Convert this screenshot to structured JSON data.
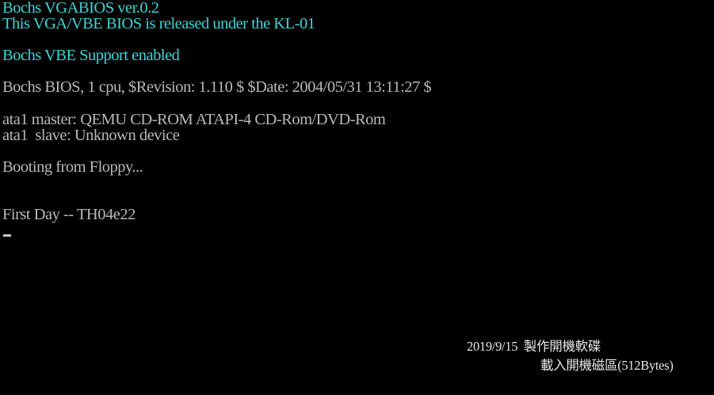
{
  "console": {
    "vgabios_line": "Bochs VGABIOS ver.0.2",
    "license_line": "This VGA/VBE BIOS is released under the KL-01",
    "vbe_line": "Bochs VBE Support enabled",
    "bios_line": "Bochs BIOS, 1 cpu, $Revision: 1.110 $ $Date: 2004/05/31 13:11:27 $",
    "ata_master_line": "ata1 master: QEMU CD-ROM ATAPI-4 CD-Rom/DVD-Rom",
    "ata_slave_line": "ata1  slave: Unknown device",
    "boot_line": "Booting from Floppy...",
    "message_line": "First Day -- TH04e22"
  },
  "caption": {
    "line1": "2019/9/15  製作開機軟碟",
    "line2": "載入開機磁區(512Bytes)"
  },
  "colors": {
    "background": "#000000",
    "cyan_text": "#3ed3d6",
    "gray_text": "#b8b8b8",
    "caption_text": "#e8e8e8"
  }
}
